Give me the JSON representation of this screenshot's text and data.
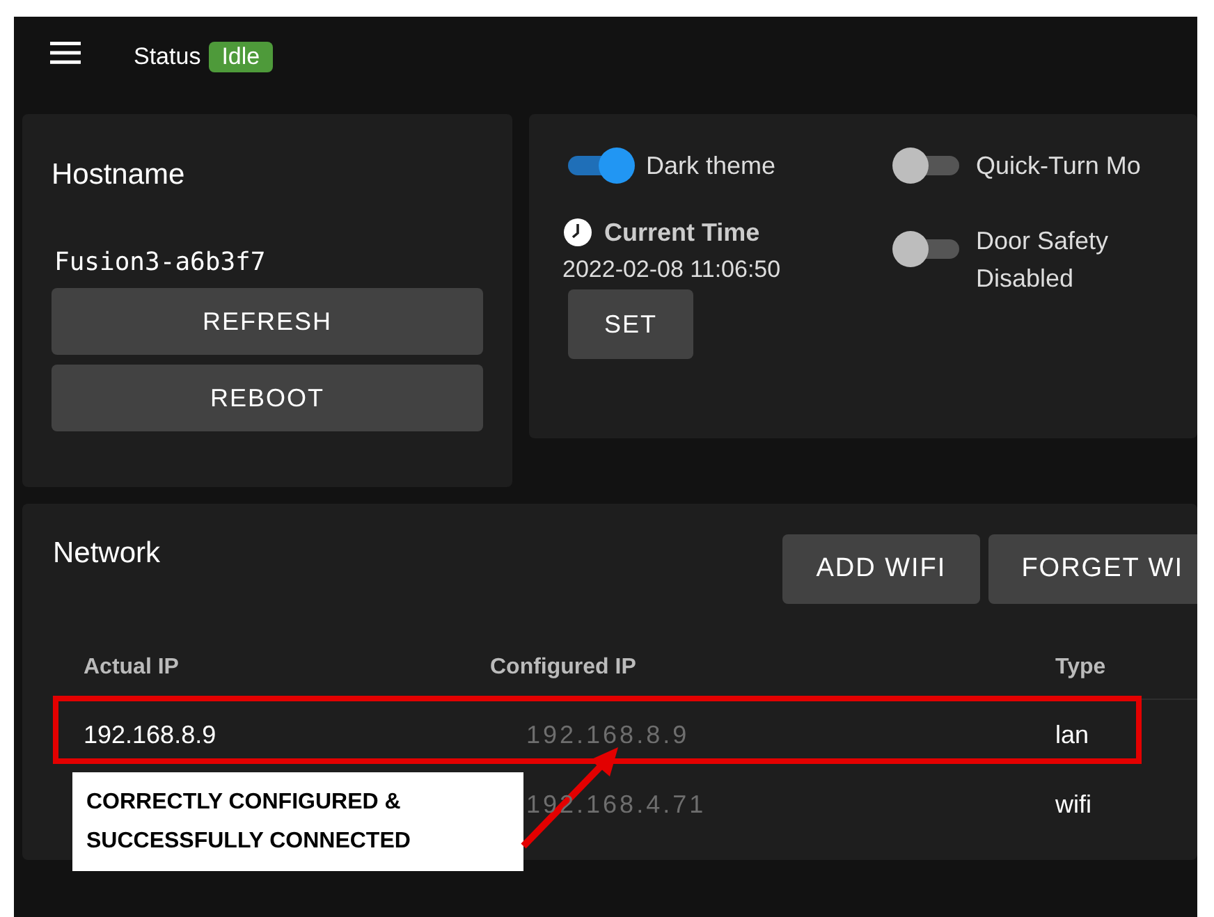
{
  "app_bar": {
    "status_label": "Status",
    "status_badge": "Idle"
  },
  "hostname_card": {
    "title": "Hostname",
    "hostname": "Fusion3-a6b3f7",
    "buttons": [
      "REFRESH",
      "REBOOT"
    ]
  },
  "settings_card": {
    "toggles": [
      {
        "label": "Dark theme",
        "on": true
      },
      {
        "label": "Quick-Turn Mo",
        "on": false
      },
      {
        "label": "Door Safety Disabled",
        "on": false
      }
    ],
    "current_time": {
      "title": "Current Time",
      "value": "2022-02-08 11:06:50",
      "button": "SET"
    }
  },
  "network_card": {
    "title": "Network",
    "buttons": [
      "ADD WIFI",
      "FORGET WI"
    ],
    "columns": [
      "Actual IP",
      "Configured IP",
      "Type"
    ],
    "rows": [
      {
        "actual_ip": "192.168.8.9",
        "configured_ip": "192.168.8.9",
        "type": "lan"
      },
      {
        "configured_ip": "192.168.4.71",
        "type": "wifi"
      }
    ]
  },
  "annotation": {
    "text": "CORRECTLY CONFIGURED &\nSUCCESSFULLY CONNECTED"
  }
}
